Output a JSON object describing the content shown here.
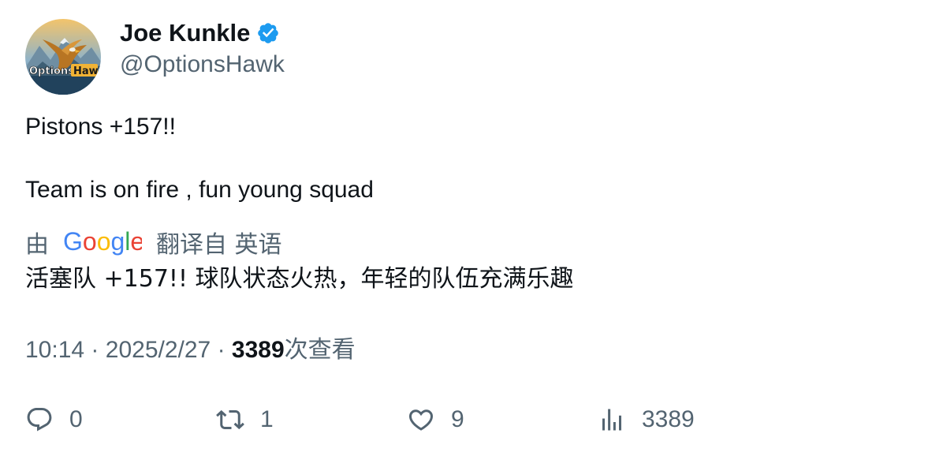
{
  "author": {
    "display_name": "Joe Kunkle",
    "handle": "@OptionsHawk",
    "verified": true,
    "avatar_logo_text": "OptionsHawk"
  },
  "tweet": {
    "lines": [
      "Pistons +157!!",
      "Team is on fire , fun young squad"
    ],
    "translation": {
      "prefix": "由",
      "provider": "Google",
      "suffix": "翻译自 英语",
      "text": "活塞队 +157!! 球队状态火热，年轻的队伍充满乐趣"
    },
    "time": "10:14",
    "separator": "·",
    "date": "2025/2/27",
    "views_count": "3389",
    "views_label": "次查看"
  },
  "actions": {
    "reply": {
      "icon": "reply-icon",
      "count": "0"
    },
    "retweet": {
      "icon": "retweet-icon",
      "count": "1"
    },
    "like": {
      "icon": "heart-icon",
      "count": "9"
    },
    "views": {
      "icon": "views-icon",
      "count": "3389"
    }
  },
  "colors": {
    "text": "#0f1419",
    "secondary": "#536471",
    "verified": "#1d9bf0"
  }
}
